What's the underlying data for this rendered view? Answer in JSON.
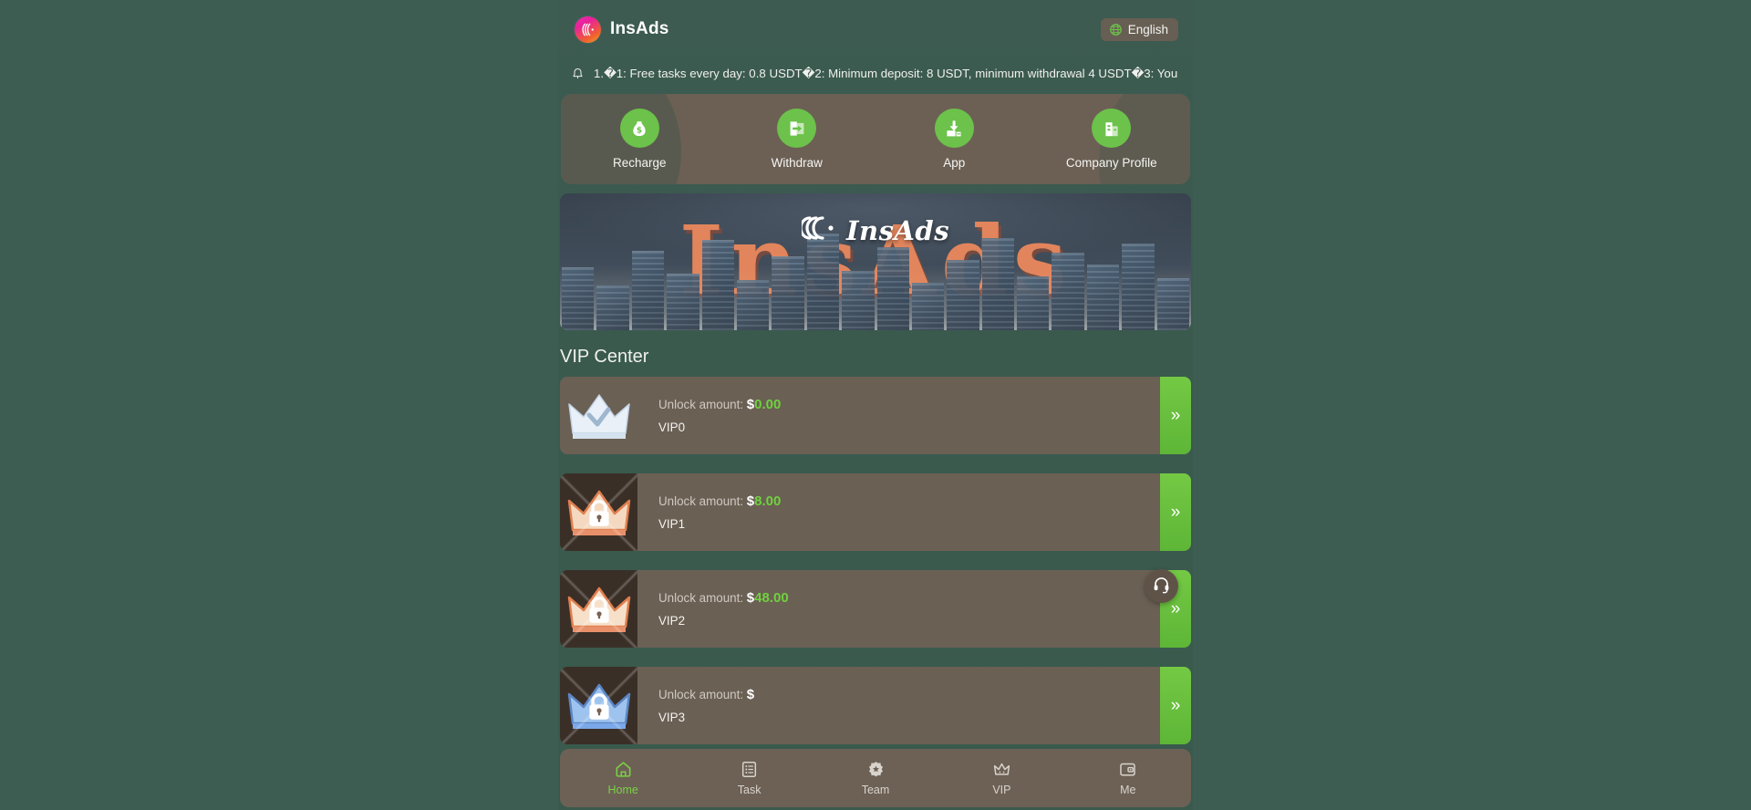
{
  "header": {
    "brand_name": "InsAds",
    "logo_icon": "insads-logo-icon",
    "language": {
      "label": "English",
      "icon": "globe-icon"
    }
  },
  "notice": {
    "icon": "bell-icon",
    "text": "1.�1: Free tasks every day: 0.8 USDT�2: Minimum deposit: 8 USDT, minimum withdrawal 4 USDT�3: You"
  },
  "quick_actions": [
    {
      "label": "Recharge",
      "icon": "money-bag-icon"
    },
    {
      "label": "Withdraw",
      "icon": "withdraw-door-icon"
    },
    {
      "label": "App",
      "icon": "download-app-icon"
    },
    {
      "label": "Company Profile",
      "icon": "building-icon"
    }
  ],
  "banner": {
    "wordmark": "InsAds",
    "background_text": "InsAds",
    "logo_icon": "insads-script-logo-icon"
  },
  "vip": {
    "section_title": "VIP Center",
    "unlock_label": "Unlock amount:",
    "currency": "$",
    "rows": [
      {
        "level": "VIP0",
        "amount": "0.00",
        "locked": false,
        "crown_color": "#e9f0f8",
        "icon": "crown-icon"
      },
      {
        "level": "VIP1",
        "amount": "8.00",
        "locked": true,
        "crown_color": "#f0a070",
        "icon": "crown-locked-icon"
      },
      {
        "level": "VIP2",
        "amount": "48.00",
        "locked": true,
        "crown_color": "#f0a070",
        "icon": "crown-locked-icon"
      },
      {
        "level": "VIP3",
        "amount": "",
        "locked": true,
        "crown_color": "#7aa8e8",
        "icon": "crown-locked-icon"
      }
    ],
    "go_icon": "double-chevron-right-icon"
  },
  "support": {
    "icon": "headset-icon"
  },
  "tabbar": [
    {
      "label": "Home",
      "icon": "home-icon",
      "active": true
    },
    {
      "label": "Task",
      "icon": "list-icon",
      "active": false
    },
    {
      "label": "Team",
      "icon": "team-badge-icon",
      "active": false
    },
    {
      "label": "VIP",
      "icon": "crown-icon",
      "active": false
    },
    {
      "label": "Me",
      "icon": "wallet-icon",
      "active": false
    }
  ],
  "colors": {
    "page_background": "#3e5d52",
    "card_background": "#6b6054",
    "accent_green": "#6cc24a",
    "amount_green": "#6fd13e",
    "banner_orange": "#f08a5d"
  }
}
